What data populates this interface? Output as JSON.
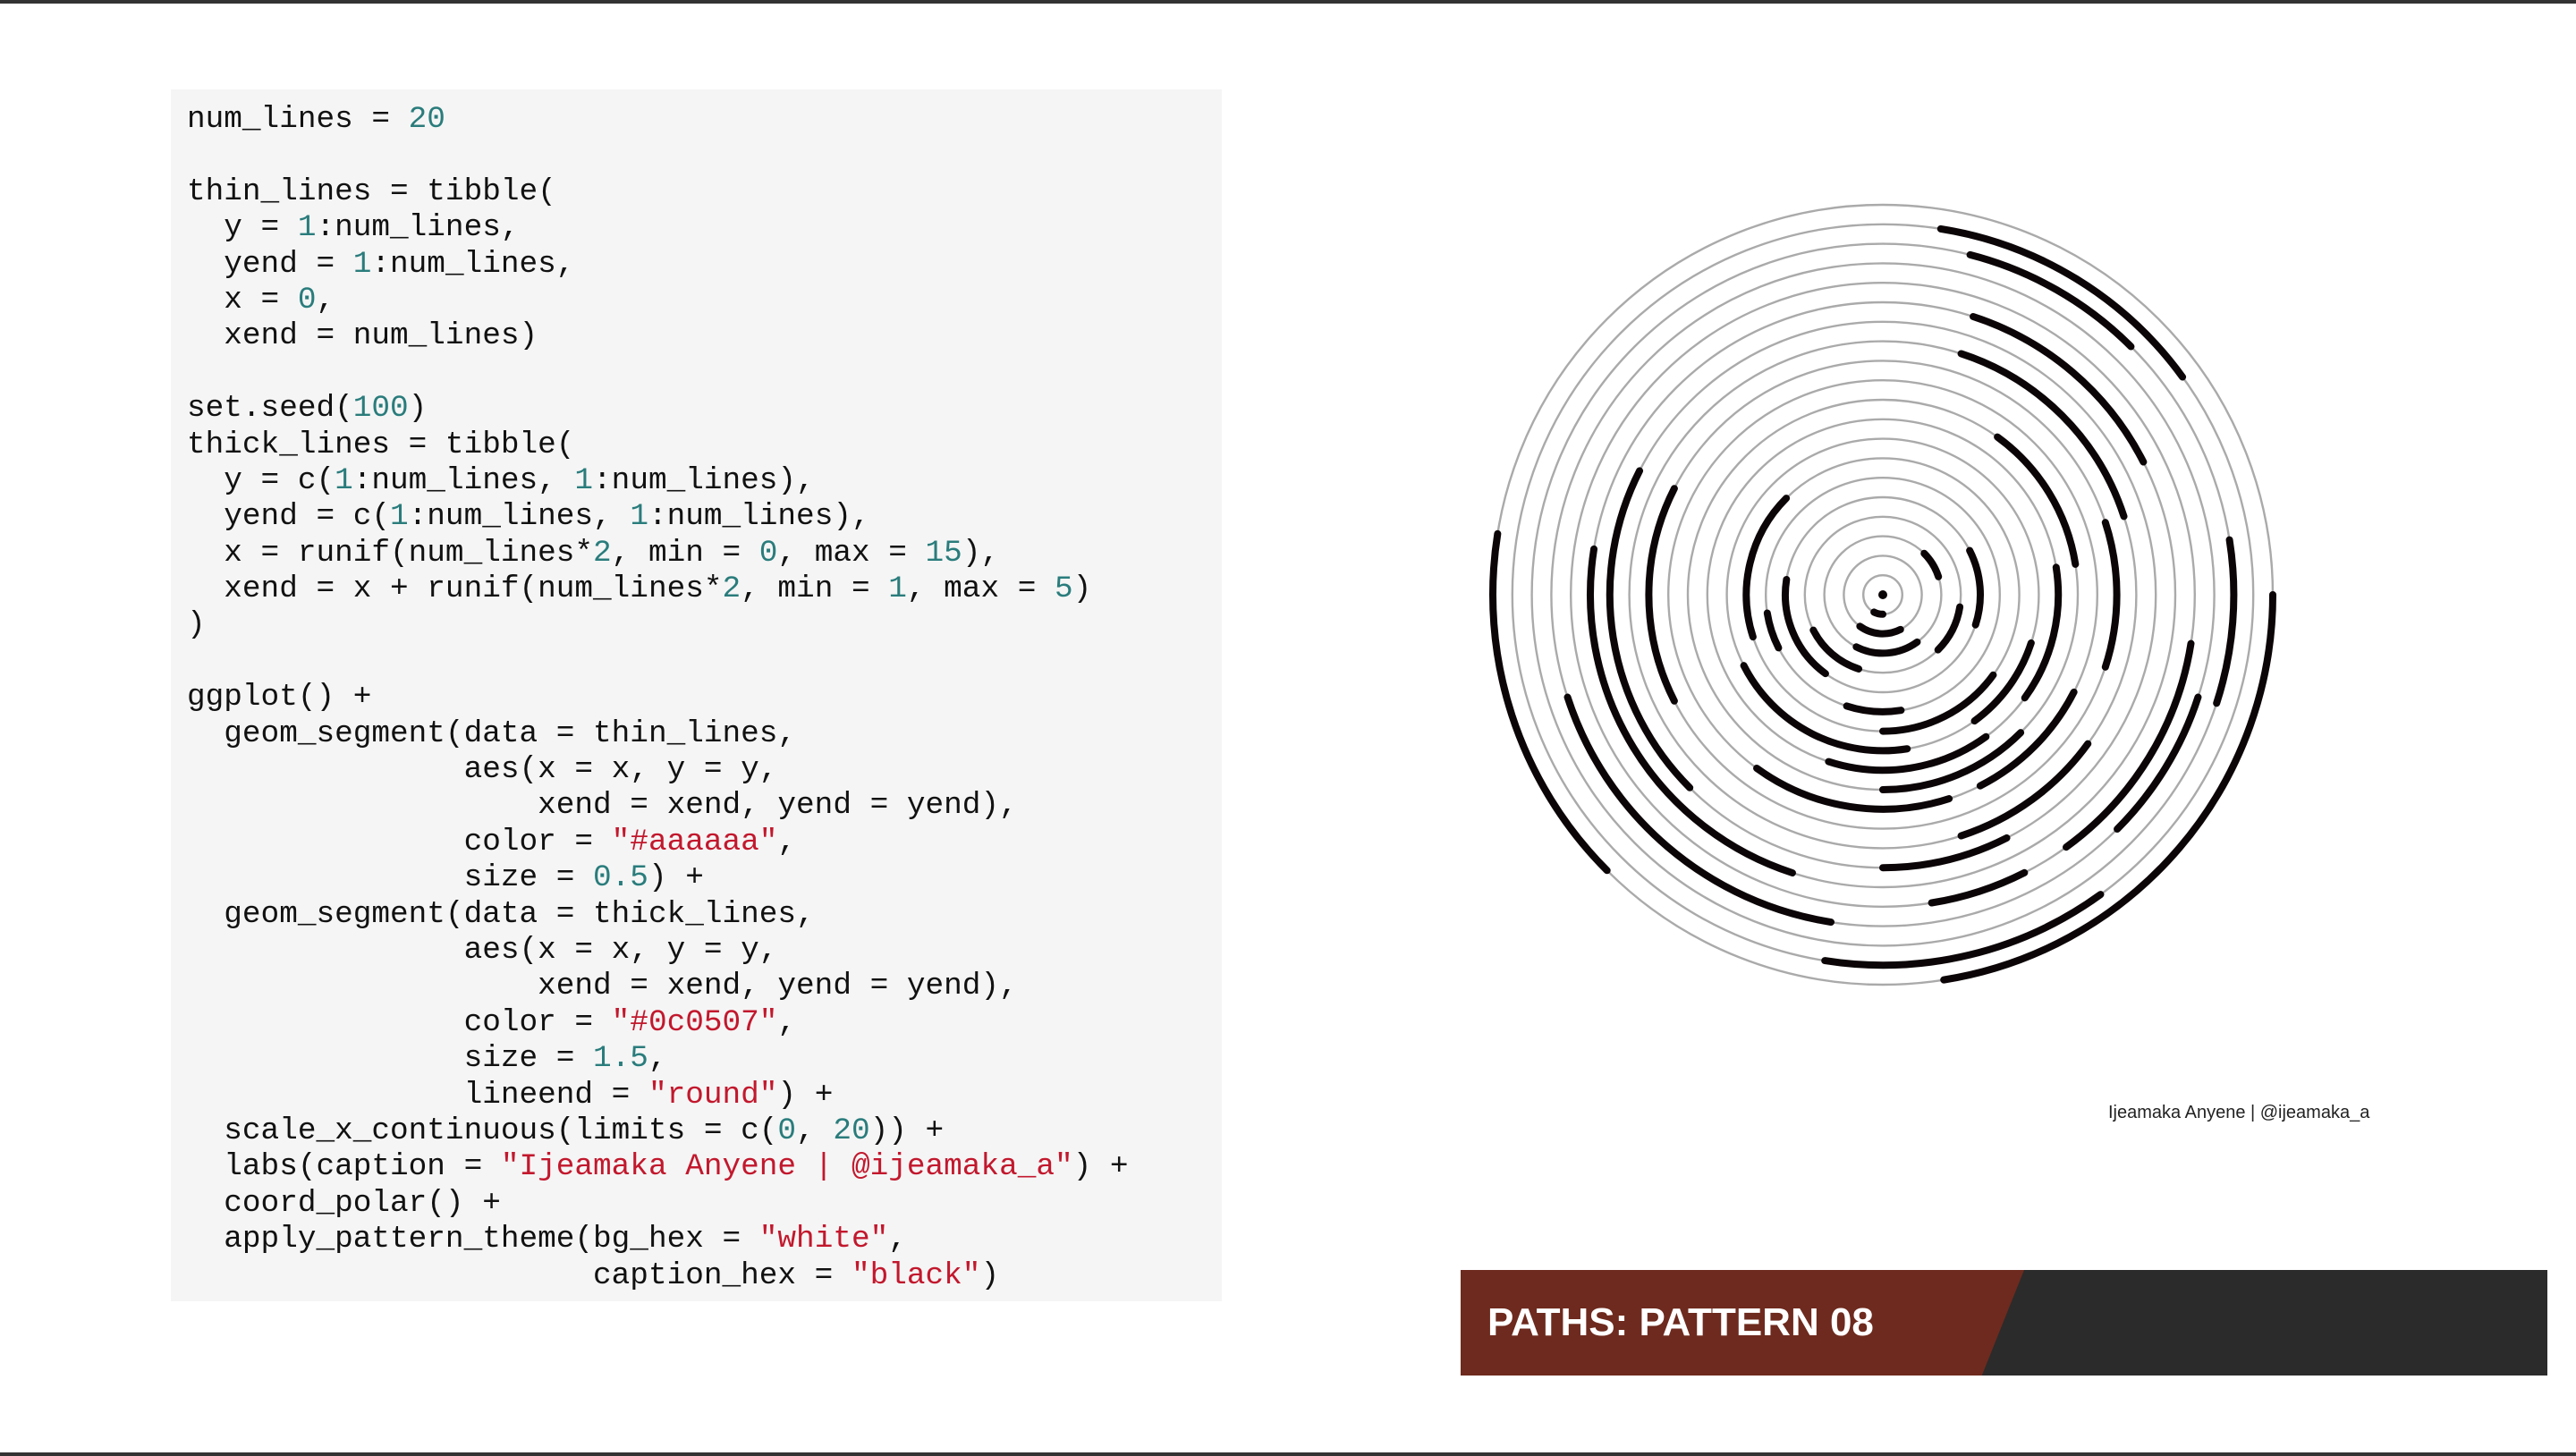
{
  "code": {
    "lines": [
      [
        {
          "t": "num_lines = "
        },
        {
          "t": "20",
          "k": "num"
        }
      ],
      [],
      [
        {
          "t": "thin_lines = tibble("
        }
      ],
      [
        {
          "t": "  y = "
        },
        {
          "t": "1",
          "k": "num"
        },
        {
          "t": ":num_lines,"
        }
      ],
      [
        {
          "t": "  yend = "
        },
        {
          "t": "1",
          "k": "num"
        },
        {
          "t": ":num_lines,"
        }
      ],
      [
        {
          "t": "  x = "
        },
        {
          "t": "0",
          "k": "num"
        },
        {
          "t": ","
        }
      ],
      [
        {
          "t": "  xend = num_lines)"
        }
      ],
      [],
      [
        {
          "t": "set.seed("
        },
        {
          "t": "100",
          "k": "num"
        },
        {
          "t": ")"
        }
      ],
      [
        {
          "t": "thick_lines = tibble("
        }
      ],
      [
        {
          "t": "  y = c("
        },
        {
          "t": "1",
          "k": "num"
        },
        {
          "t": ":num_lines, "
        },
        {
          "t": "1",
          "k": "num"
        },
        {
          "t": ":num_lines),"
        }
      ],
      [
        {
          "t": "  yend = c("
        },
        {
          "t": "1",
          "k": "num"
        },
        {
          "t": ":num_lines, "
        },
        {
          "t": "1",
          "k": "num"
        },
        {
          "t": ":num_lines),"
        }
      ],
      [
        {
          "t": "  x = runif(num_lines*"
        },
        {
          "t": "2",
          "k": "num"
        },
        {
          "t": ", min = "
        },
        {
          "t": "0",
          "k": "num"
        },
        {
          "t": ", max = "
        },
        {
          "t": "15",
          "k": "num"
        },
        {
          "t": "),"
        }
      ],
      [
        {
          "t": "  xend = x + runif(num_lines*"
        },
        {
          "t": "2",
          "k": "num"
        },
        {
          "t": ", min = "
        },
        {
          "t": "1",
          "k": "num"
        },
        {
          "t": ", max = "
        },
        {
          "t": "5",
          "k": "num"
        },
        {
          "t": ")"
        }
      ],
      [
        {
          "t": ")"
        }
      ],
      [],
      [
        {
          "t": "ggplot() +"
        }
      ],
      [
        {
          "t": "  geom_segment(data = thin_lines,"
        }
      ],
      [
        {
          "t": "               aes(x = x, y = y,"
        }
      ],
      [
        {
          "t": "                   xend = xend, yend = yend),"
        }
      ],
      [
        {
          "t": "               color = "
        },
        {
          "t": "\"#aaaaaa\"",
          "k": "str"
        },
        {
          "t": ","
        }
      ],
      [
        {
          "t": "               size = "
        },
        {
          "t": "0.5",
          "k": "num"
        },
        {
          "t": ") +"
        }
      ],
      [
        {
          "t": "  geom_segment(data = thick_lines,"
        }
      ],
      [
        {
          "t": "               aes(x = x, y = y,"
        }
      ],
      [
        {
          "t": "                   xend = xend, yend = yend),"
        }
      ],
      [
        {
          "t": "               color = "
        },
        {
          "t": "\"#0c0507\"",
          "k": "str"
        },
        {
          "t": ","
        }
      ],
      [
        {
          "t": "               size = "
        },
        {
          "t": "1.5",
          "k": "num"
        },
        {
          "t": ","
        }
      ],
      [
        {
          "t": "               lineend = "
        },
        {
          "t": "\"round\"",
          "k": "str"
        },
        {
          "t": ") +"
        }
      ],
      [
        {
          "t": "  scale_x_continuous(limits = c("
        },
        {
          "t": "0",
          "k": "num"
        },
        {
          "t": ", "
        },
        {
          "t": "20",
          "k": "num"
        },
        {
          "t": ")) +"
        }
      ],
      [
        {
          "t": "  labs(caption = "
        },
        {
          "t": "\"Ijeamaka Anyene | @ijeamaka_a\"",
          "k": "str"
        },
        {
          "t": ") +"
        }
      ],
      [
        {
          "t": "  coord_polar() +"
        }
      ],
      [
        {
          "t": "  apply_pattern_theme(bg_hex = "
        },
        {
          "t": "\"white\"",
          "k": "str"
        },
        {
          "t": ","
        }
      ],
      [
        {
          "t": "                      caption_hex = "
        },
        {
          "t": "\"black\"",
          "k": "str"
        },
        {
          "t": ")"
        }
      ]
    ]
  },
  "plot": {
    "caption": "Ijeamaka Anyene | @ijeamaka_a",
    "num_lines": 20,
    "x_limits": [
      0,
      20
    ],
    "thin_color": "#aaaaaa",
    "thick_color": "#0c0507",
    "thick_segments": [
      {
        "y": 1,
        "x": 10.0,
        "xend": 11.5
      },
      {
        "y": 2,
        "x": 8.5,
        "xend": 12.0
      },
      {
        "y": 3,
        "x": 2.5,
        "xend": 4.0
      },
      {
        "y": 3,
        "x": 8.0,
        "xend": 11.5
      },
      {
        "y": 4,
        "x": 5.5,
        "xend": 7.5
      },
      {
        "y": 4,
        "x": 11.0,
        "xend": 13.5
      },
      {
        "y": 5,
        "x": 3.5,
        "xend": 6.0
      },
      {
        "y": 5,
        "x": 12.0,
        "xend": 15.5
      },
      {
        "y": 6,
        "x": 9.5,
        "xend": 11.0
      },
      {
        "y": 6,
        "x": 13.5,
        "xend": 14.5
      },
      {
        "y": 7,
        "x": 7.0,
        "xend": 10.0
      },
      {
        "y": 7,
        "x": 14.0,
        "xend": 17.5
      },
      {
        "y": 8,
        "x": 6.0,
        "xend": 8.0
      },
      {
        "y": 8,
        "x": 9.5,
        "xend": 13.5
      },
      {
        "y": 9,
        "x": 4.5,
        "xend": 7.0
      },
      {
        "y": 9,
        "x": 8.0,
        "xend": 11.0
      },
      {
        "y": 10,
        "x": 2.0,
        "xend": 4.5
      },
      {
        "y": 10,
        "x": 7.5,
        "xend": 10.0
      },
      {
        "y": 11,
        "x": 6.5,
        "xend": 8.5
      },
      {
        "y": 11,
        "x": 9.0,
        "xend": 12.0
      },
      {
        "y": 12,
        "x": 4.0,
        "xend": 6.0
      },
      {
        "y": 12,
        "x": 13.5,
        "xend": 16.5
      },
      {
        "y": 13,
        "x": 1.0,
        "xend": 4.0
      },
      {
        "y": 13,
        "x": 7.0,
        "xend": 9.0
      },
      {
        "y": 14,
        "x": 8.5,
        "xend": 10.0
      },
      {
        "y": 14,
        "x": 12.5,
        "xend": 16.5
      },
      {
        "y": 15,
        "x": 1.0,
        "xend": 3.5
      },
      {
        "y": 15,
        "x": 11.0,
        "xend": 15.5
      },
      {
        "y": 16,
        "x": 5.5,
        "xend": 8.0
      },
      {
        "y": 16,
        "x": 8.5,
        "xend": 9.5
      },
      {
        "y": 17,
        "x": 6.0,
        "xend": 7.5
      },
      {
        "y": 17,
        "x": 10.5,
        "xend": 14.0
      },
      {
        "y": 18,
        "x": 0.8,
        "xend": 2.5
      },
      {
        "y": 18,
        "x": 4.5,
        "xend": 6.0
      },
      {
        "y": 19,
        "x": 0.5,
        "xend": 3.0
      },
      {
        "y": 19,
        "x": 8.0,
        "xend": 10.5
      },
      {
        "y": 20,
        "x": 5.0,
        "xend": 9.5
      },
      {
        "y": 20,
        "x": 12.5,
        "xend": 15.5
      }
    ]
  },
  "banner": {
    "title": "PATHS: PATTERN 08",
    "accent_color": "#6e2a1e",
    "bg_color": "#2b2b2b"
  }
}
